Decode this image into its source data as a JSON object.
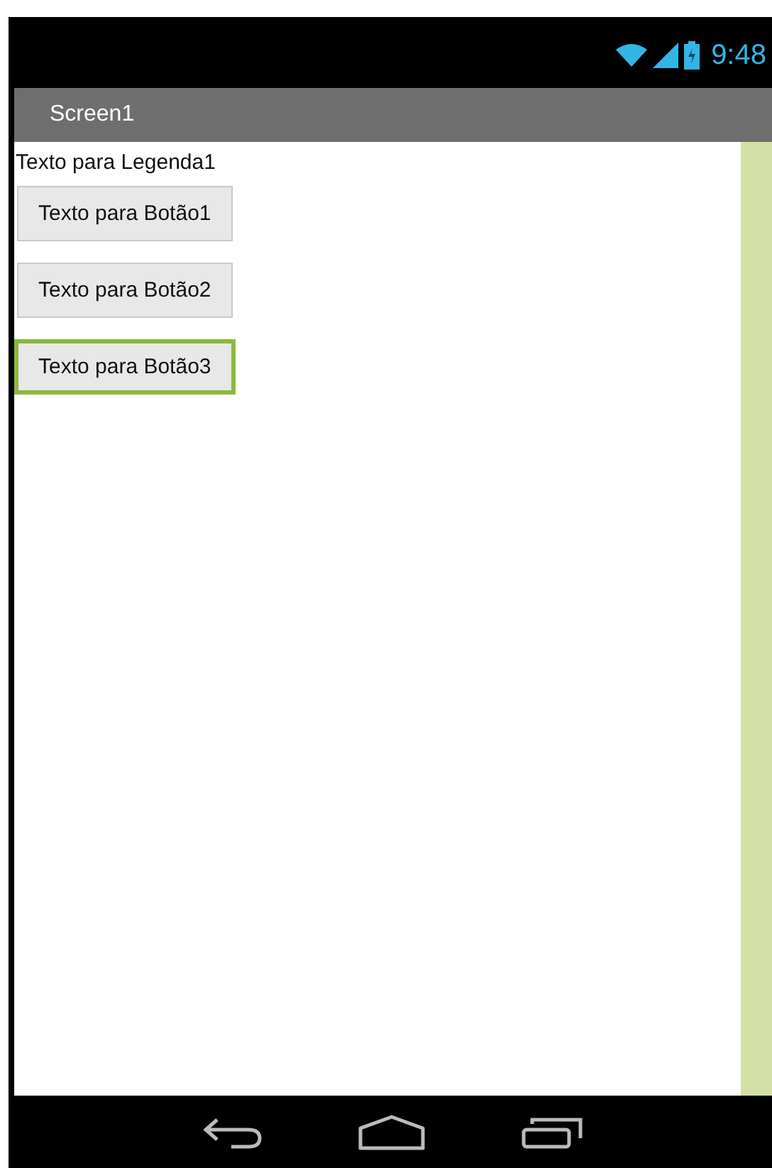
{
  "status_bar": {
    "time": "9:48"
  },
  "title_bar": {
    "title": "Screen1"
  },
  "label": "Texto para Legenda1",
  "buttons": [
    {
      "label": "Texto para Botão1",
      "selected": false
    },
    {
      "label": "Texto para Botão2",
      "selected": false
    },
    {
      "label": "Texto para Botão3",
      "selected": true
    }
  ]
}
